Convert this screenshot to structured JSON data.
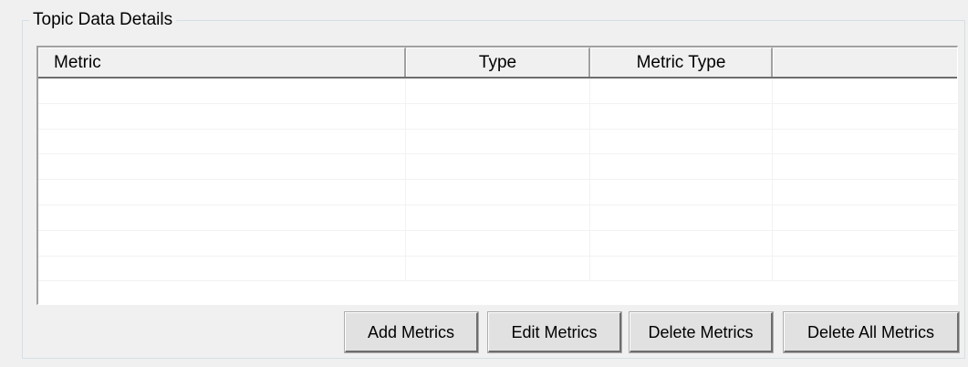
{
  "groupbox": {
    "title": "Topic Data Details"
  },
  "listview": {
    "columns": [
      "Metric",
      "Type",
      "Metric Type",
      ""
    ],
    "rows": []
  },
  "buttons": {
    "add": "Add Metrics",
    "edit": "Edit Metrics",
    "delete": "Delete Metrics",
    "delete_all": "Delete All Metrics"
  }
}
